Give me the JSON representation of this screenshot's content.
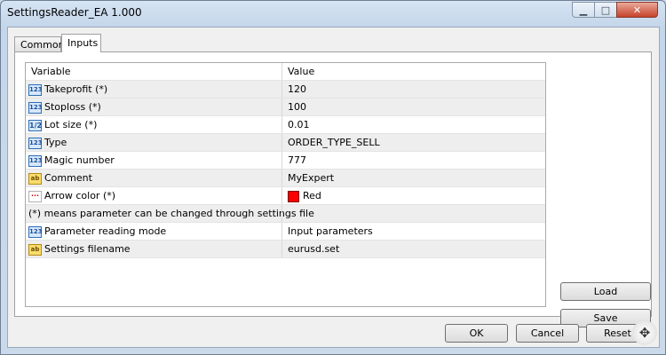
{
  "window": {
    "title": "SettingsReader_EA 1.000"
  },
  "tabs": [
    {
      "label": "Common"
    },
    {
      "label": "Inputs"
    }
  ],
  "table": {
    "headers": {
      "variable": "Variable",
      "value": "Value"
    },
    "rows": [
      {
        "variable": "Takeprofit (*)",
        "value": "120",
        "icon": "number-icon"
      },
      {
        "variable": "Stoploss (*)",
        "value": "100",
        "icon": "number-icon"
      },
      {
        "variable": "Lot size (*)",
        "value": "0.01",
        "icon": "fraction-icon"
      },
      {
        "variable": "Type",
        "value": "ORDER_TYPE_SELL",
        "icon": "number-icon"
      },
      {
        "variable": "Magic number",
        "value": "777",
        "icon": "number-icon"
      },
      {
        "variable": "Comment",
        "value": "MyExpert",
        "icon": "string-icon"
      },
      {
        "variable": "Arrow color (*)",
        "value": "Red",
        "icon": "color-icon",
        "color": "#ff0000"
      },
      {
        "variable": "(*) means parameter can be changed through settings file",
        "value": ""
      },
      {
        "variable": "Parameter reading mode",
        "value": "Input parameters",
        "icon": "number-icon"
      },
      {
        "variable": "Settings filename",
        "value": "eurusd.set",
        "icon": "string-icon"
      }
    ]
  },
  "buttons": {
    "load": "Load",
    "save": "Save",
    "ok": "OK",
    "cancel": "Cancel",
    "reset": "Reset"
  },
  "icon_glyphs": {
    "number": "123",
    "fraction": "1/2",
    "string": "ab",
    "color": "···"
  }
}
